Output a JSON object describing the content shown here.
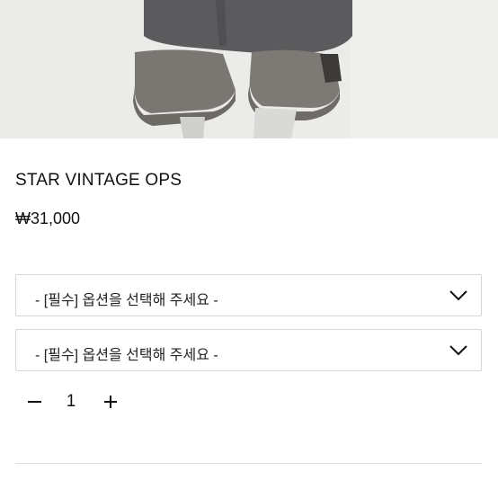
{
  "product": {
    "title": "STAR VINTAGE OPS",
    "price": "₩31,000"
  },
  "options": [
    {
      "label": "- [필수] 옵션을 선택해 주세요 -",
      "icon": "chevron-down-icon"
    },
    {
      "label": "- [필수] 옵션을 선택해 주세요 -",
      "icon": "chevron-down-icon"
    }
  ],
  "quantity": {
    "value": "1",
    "decrement_icon": "minus-icon",
    "increment_icon": "plus-icon"
  }
}
